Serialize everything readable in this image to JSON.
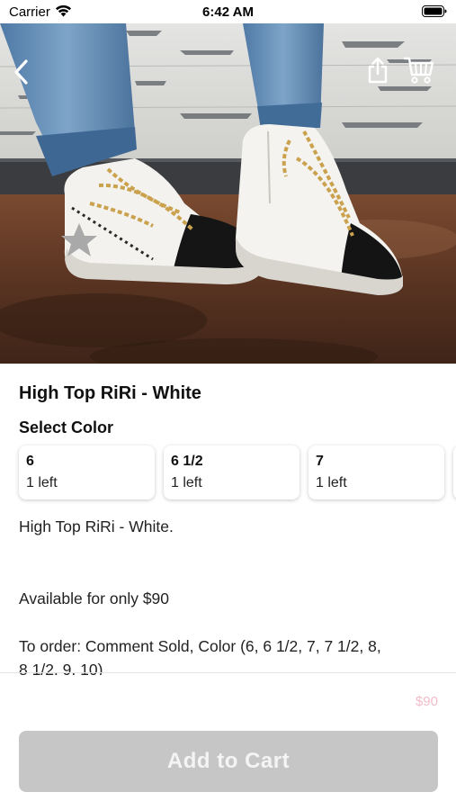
{
  "status_bar": {
    "carrier": "Carrier",
    "time": "6:42 AM"
  },
  "hero": {
    "icons": [
      "chevron-left-icon",
      "share-icon",
      "cart-icon"
    ]
  },
  "product": {
    "title": "High Top RiRi - White",
    "select_label": "Select Color",
    "options": [
      {
        "size": "6",
        "stock": "1 left"
      },
      {
        "size": "6 1/2",
        "stock": "1 left"
      },
      {
        "size": "7",
        "stock": "1 left"
      }
    ],
    "description": [
      "High Top RiRi - White.",
      "Available for only $90",
      "To order: Comment Sold, Color (6, 6 1/2, 7, 7 1/2, 8,",
      "8 1/2, 9, 10)"
    ]
  },
  "footer": {
    "price": "$90",
    "add_to_cart_label": "Add to Cart"
  },
  "colors": {
    "price": "#f2bcc8",
    "button_disabled": "#c6c6c6",
    "button_text": "#f4f4f4"
  }
}
